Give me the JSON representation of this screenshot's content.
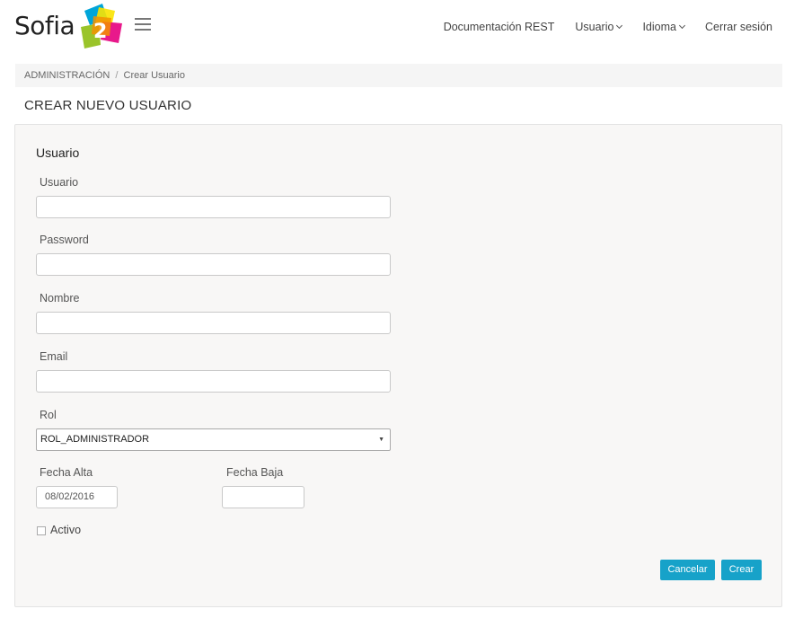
{
  "header": {
    "logo_text": "Sofia",
    "logo_mark_digit": "2",
    "nav": [
      {
        "label": "Documentación REST",
        "has_dropdown": false
      },
      {
        "label": "Usuario",
        "has_dropdown": true
      },
      {
        "label": "Idioma",
        "has_dropdown": true
      },
      {
        "label": "Cerrar sesión",
        "has_dropdown": false
      }
    ]
  },
  "breadcrumb": {
    "parent": "ADMINISTRACIÓN",
    "separator": "/",
    "current": "Crear Usuario"
  },
  "page_title": "CREAR NUEVO USUARIO",
  "form": {
    "section_title": "Usuario",
    "fields": {
      "usuario": {
        "label": "Usuario",
        "value": ""
      },
      "password": {
        "label": "Password",
        "value": ""
      },
      "nombre": {
        "label": "Nombre",
        "value": ""
      },
      "email": {
        "label": "Email",
        "value": ""
      }
    },
    "rol": {
      "label": "Rol",
      "selected": "ROL_ADMINISTRADOR"
    },
    "fecha_alta": {
      "label": "Fecha Alta",
      "value": "08/02/2016"
    },
    "fecha_baja": {
      "label": "Fecha Baja",
      "value": ""
    },
    "activo": {
      "label": "Activo",
      "checked": false
    },
    "buttons": {
      "cancel": "Cancelar",
      "create": "Crear"
    }
  },
  "colors": {
    "accent": "#17a2c9",
    "panel_bg": "#f8f7f6",
    "breadcrumb_bg": "#f5f5f5",
    "logo_colors": [
      "#00a5d9",
      "#f39200",
      "#e6007e",
      "#95c11f",
      "#f9e300"
    ]
  }
}
